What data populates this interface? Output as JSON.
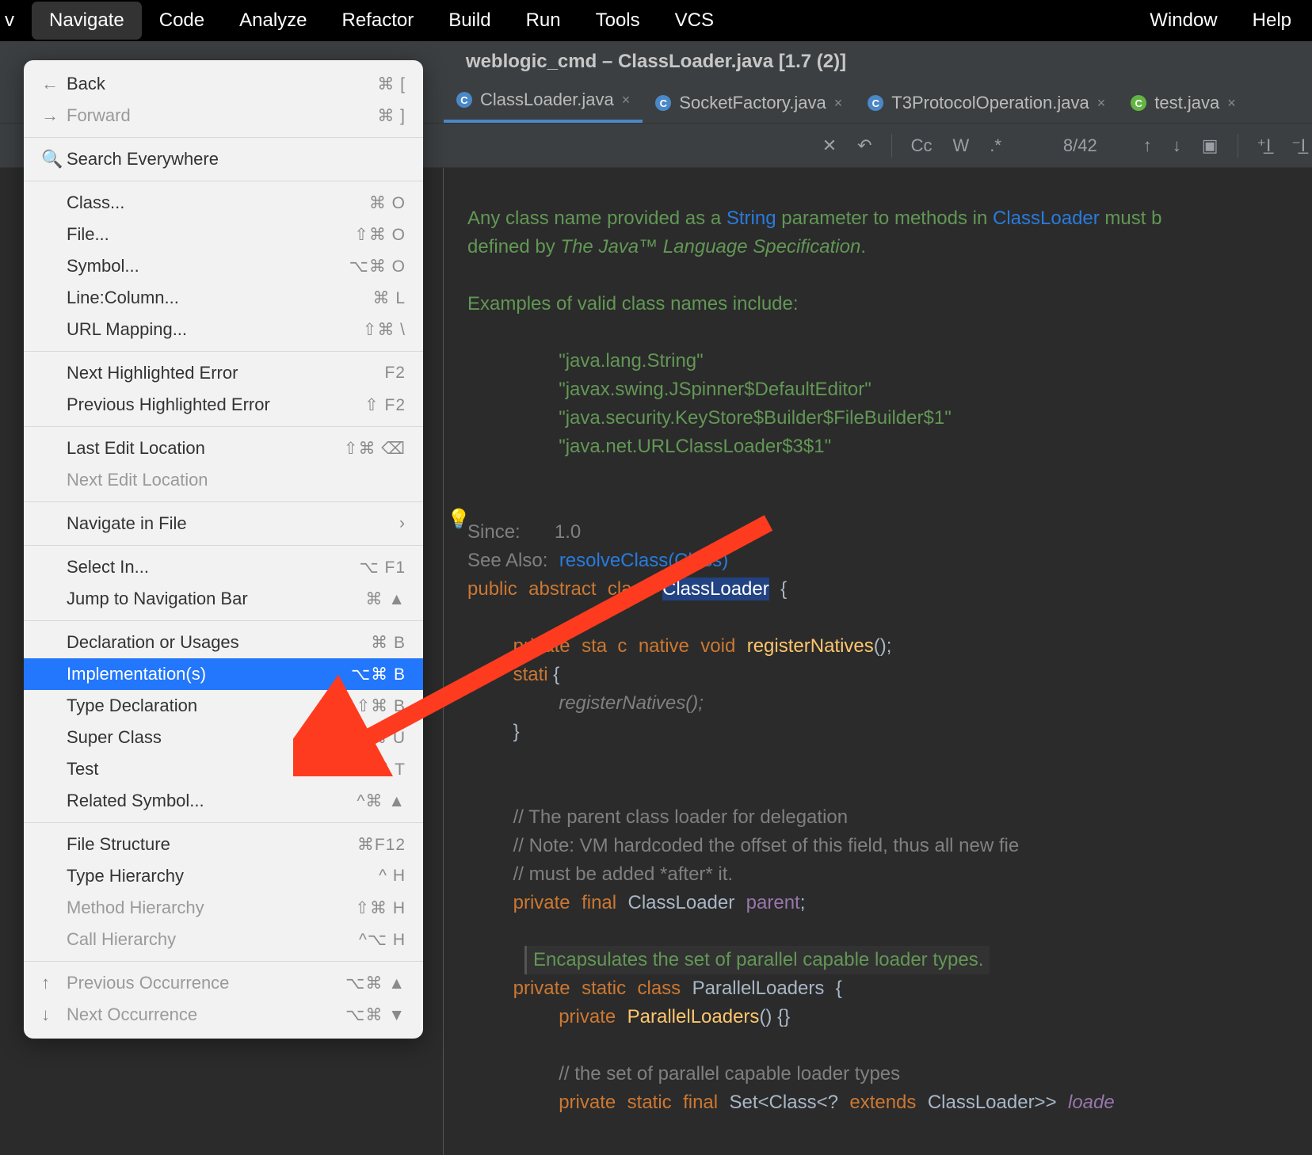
{
  "menubar": {
    "items": [
      "Navigate",
      "Code",
      "Analyze",
      "Refactor",
      "Build",
      "Run",
      "Tools",
      "VCS"
    ],
    "right_items": [
      "Window",
      "Help"
    ],
    "active_index": 0
  },
  "window_title": "weblogic_cmd – ClassLoader.java [1.7 (2)]",
  "tabs": [
    {
      "label": "ClassLoader.java",
      "icon_color": "c",
      "active": true
    },
    {
      "label": "SocketFactory.java",
      "icon_color": "c",
      "active": false
    },
    {
      "label": "T3ProtocolOperation.java",
      "icon_color": "c",
      "active": false
    },
    {
      "label": "test.java",
      "icon_color": "cg",
      "active": false
    }
  ],
  "find_toolbar": {
    "match": "8/42"
  },
  "dropdown": {
    "groups": [
      [
        {
          "icon": "←",
          "label": "Back",
          "shortcut": "⌘ [",
          "disabled": false
        },
        {
          "icon": "→",
          "label": "Forward",
          "shortcut": "⌘ ]",
          "disabled": true
        }
      ],
      [
        {
          "icon": "🔍",
          "label": "Search Everywhere",
          "shortcut": "",
          "disabled": false
        }
      ],
      [
        {
          "label": "Class...",
          "shortcut": "⌘ O"
        },
        {
          "label": "File...",
          "shortcut": "⇧⌘ O"
        },
        {
          "label": "Symbol...",
          "shortcut": "⌥⌘ O"
        },
        {
          "label": "Line:Column...",
          "shortcut": "⌘ L"
        },
        {
          "label": "URL Mapping...",
          "shortcut": "⇧⌘ \\"
        }
      ],
      [
        {
          "label": "Next Highlighted Error",
          "shortcut": "F2"
        },
        {
          "label": "Previous Highlighted Error",
          "shortcut": "⇧ F2"
        }
      ],
      [
        {
          "label": "Last Edit Location",
          "shortcut": "⇧⌘ ⌫"
        },
        {
          "label": "Next Edit Location",
          "shortcut": "",
          "disabled": true
        }
      ],
      [
        {
          "label": "Navigate in File",
          "shortcut": "›",
          "submenu": true
        }
      ],
      [
        {
          "label": "Select In...",
          "shortcut": "⌥ F1"
        },
        {
          "label": "Jump to Navigation Bar",
          "shortcut": "⌘ ▲"
        }
      ],
      [
        {
          "label": "Declaration or Usages",
          "shortcut": "⌘ B"
        },
        {
          "label": "Implementation(s)",
          "shortcut": "⌥⌘ B",
          "selected": true
        },
        {
          "label": "Type Declaration",
          "shortcut": "⇧⌘ B"
        },
        {
          "label": "Super Class",
          "shortcut": "⌘ U"
        },
        {
          "label": "Test",
          "shortcut": "⇧⌘ T"
        },
        {
          "label": "Related Symbol...",
          "shortcut": "^⌘ ▲"
        }
      ],
      [
        {
          "label": "File Structure",
          "shortcut": "⌘F12"
        },
        {
          "label": "Type Hierarchy",
          "shortcut": "^ H"
        },
        {
          "label": "Method Hierarchy",
          "shortcut": "⇧⌘ H",
          "disabled": true
        },
        {
          "label": "Call Hierarchy",
          "shortcut": "^⌥ H",
          "disabled": true
        }
      ],
      [
        {
          "icon": "↑",
          "label": "Previous Occurrence",
          "shortcut": "⌥⌘ ▲",
          "disabled": true
        },
        {
          "icon": "↓",
          "label": "Next Occurrence",
          "shortcut": "⌥⌘ ▼",
          "disabled": true
        }
      ]
    ]
  },
  "code": {
    "doc1": "Any class name provided as a ",
    "doc_link1": "String",
    "doc2": " parameter to methods in ",
    "doc_link2": "ClassLoader",
    "doc3": " must b",
    "doc4": "defined by ",
    "doc_spec": "The Java™ Language Specification",
    "doc5": ".",
    "examples_label": "Examples of valid class names include:",
    "example1": "\"java.lang.String\"",
    "example2": "\"javax.swing.JSpinner$DefaultEditor\"",
    "example3": "\"java.security.KeyStore$Builder$FileBuilder$1\"",
    "example4": "\"java.net.URLClassLoader$3$1\"",
    "since_label": "Since:",
    "since_val": "1.0",
    "see_label": "See Also:",
    "see_link": "resolveClass(Class)",
    "public": "public",
    "abstract": "abstract",
    "class_kw": "class",
    "classname": "ClassLoader",
    "brace_open": "{",
    "private": "private",
    "static": "static",
    "native": "native",
    "void": "void",
    "registerNatives": "registerNatives",
    "parens_semi": "();",
    "static_block": "stati",
    "static_block2": " {",
    "registerNativesCall": "registerNatives();",
    "brace_close": "}",
    "cmt1": "// The parent class loader for delegation",
    "cmt2": "// Note: VM hardcoded the offset of this field, thus all new fie",
    "cmt3": "// must be added *after* it.",
    "final": "final",
    "ClassLoader": "ClassLoader",
    "parent": "parent",
    "semi": ";",
    "encaps": "Encapsulates the set of parallel capable loader types.",
    "ParallelLoaders": "ParallelLoaders",
    "pl_ctor": "ParallelLoaders",
    "empty_body": "() {}",
    "cmt4": "// the set of parallel capable loader types",
    "Set": "Set<Class<?",
    "extends": "extends",
    "gen_close": "ClassLoader>>",
    "loade": "loade"
  }
}
